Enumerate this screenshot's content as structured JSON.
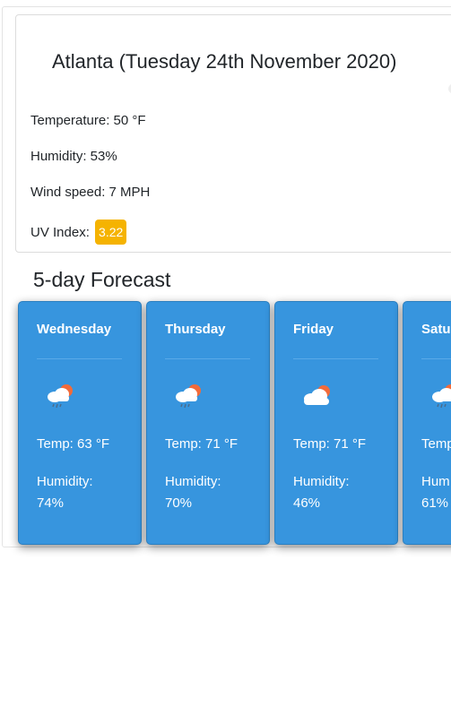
{
  "current": {
    "title": "Atlanta (Tuesday 24th November 2020)",
    "title_icon": "cloud-icon",
    "temperature": "Temperature: 50 °F",
    "humidity": "Humidity: 53%",
    "wind_speed": "Wind speed: 7 MPH",
    "uv_label": "UV Index:",
    "uv_value": "3.22",
    "uv_color": "#f5b301"
  },
  "forecast": {
    "heading": "5-day Forecast",
    "card_color": "#3795de",
    "days": [
      {
        "day": "Wednesday",
        "icon": "rain-cloud-sun-icon",
        "temp": "Temp: 63 °F",
        "humidity_label": "Humidity:",
        "humidity_value": "74%"
      },
      {
        "day": "Thursday",
        "icon": "rain-cloud-sun-icon",
        "temp": "Temp: 71 °F",
        "humidity_label": "Humidity:",
        "humidity_value": "70%"
      },
      {
        "day": "Friday",
        "icon": "cloud-sun-icon",
        "temp": "Temp: 71 °F",
        "humidity_label": "Humidity:",
        "humidity_value": "46%"
      },
      {
        "day": "Saturday",
        "icon": "rain-cloud-sun-icon",
        "temp": "Temp",
        "humidity_label": "Hum",
        "humidity_value": "61%"
      }
    ]
  }
}
